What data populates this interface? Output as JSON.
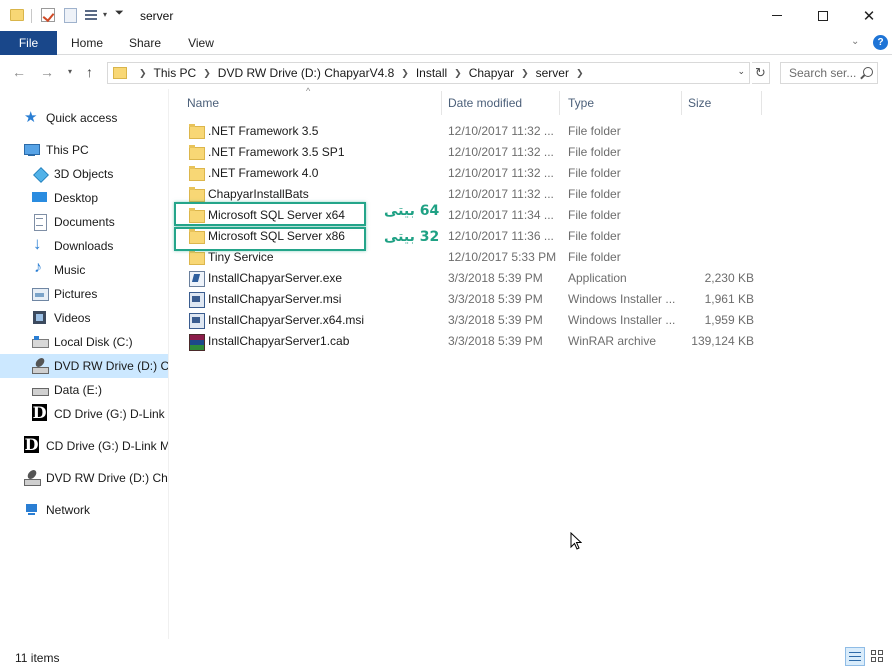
{
  "window": {
    "title": "server"
  },
  "ribbon": {
    "tabs": [
      {
        "label": "File"
      },
      {
        "label": "Home"
      },
      {
        "label": "Share"
      },
      {
        "label": "View"
      }
    ]
  },
  "address": {
    "crumbs": [
      "This PC",
      "DVD RW Drive (D:) ChapyarV4.8",
      "Install",
      "Chapyar",
      "server"
    ]
  },
  "search": {
    "placeholder": "Search ser..."
  },
  "sidebar": {
    "items": [
      {
        "label": "Quick access",
        "icon": "star-icon"
      },
      {
        "label": "This PC",
        "icon": "computer-icon"
      },
      {
        "label": "3D Objects",
        "icon": "cube-icon"
      },
      {
        "label": "Desktop",
        "icon": "desktop-icon"
      },
      {
        "label": "Documents",
        "icon": "documents-icon"
      },
      {
        "label": "Downloads",
        "icon": "download-icon"
      },
      {
        "label": "Music",
        "icon": "music-icon"
      },
      {
        "label": "Pictures",
        "icon": "pictures-icon"
      },
      {
        "label": "Videos",
        "icon": "videos-icon"
      },
      {
        "label": "Local Disk (C:)",
        "icon": "local-disk-icon"
      },
      {
        "label": "DVD RW Drive (D:) Ch",
        "icon": "dvd-drive-icon",
        "selected": true
      },
      {
        "label": "Data (E:)",
        "icon": "drive-icon"
      },
      {
        "label": "CD Drive (G:) D-Link M",
        "icon": "dlink-drive-icon"
      },
      {
        "label": "CD Drive (G:) D-Link M",
        "icon": "dlink-drive-icon"
      },
      {
        "label": "DVD RW Drive (D:) Cha",
        "icon": "dvd-drive-icon"
      },
      {
        "label": "Network",
        "icon": "network-icon"
      }
    ]
  },
  "columns": {
    "name": "Name",
    "date": "Date modified",
    "type": "Type",
    "size": "Size"
  },
  "files": [
    {
      "name": ".NET Framework 3.5",
      "date": "12/10/2017 11:32 ...",
      "type": "File folder",
      "size": "",
      "icon": "folder-icon"
    },
    {
      "name": ".NET Framework 3.5 SP1",
      "date": "12/10/2017 11:32 ...",
      "type": "File folder",
      "size": "",
      "icon": "folder-icon"
    },
    {
      "name": ".NET Framework 4.0",
      "date": "12/10/2017 11:32 ...",
      "type": "File folder",
      "size": "",
      "icon": "folder-icon"
    },
    {
      "name": "ChapyarInstallBats",
      "date": "12/10/2017 11:32 ...",
      "type": "File folder",
      "size": "",
      "icon": "folder-icon"
    },
    {
      "name": "Microsoft SQL Server x64",
      "date": "12/10/2017 11:34 ...",
      "type": "File folder",
      "size": "",
      "icon": "folder-icon"
    },
    {
      "name": "Microsoft SQL Server x86",
      "date": "12/10/2017 11:36 ...",
      "type": "File folder",
      "size": "",
      "icon": "folder-icon"
    },
    {
      "name": "Tiny Service",
      "date": "12/10/2017 5:33 PM",
      "type": "File folder",
      "size": "",
      "icon": "folder-icon"
    },
    {
      "name": "InstallChapyarServer.exe",
      "date": "3/3/2018 5:39 PM",
      "type": "Application",
      "size": "2,230 KB",
      "icon": "exe-icon"
    },
    {
      "name": "InstallChapyarServer.msi",
      "date": "3/3/2018 5:39 PM",
      "type": "Windows Installer ...",
      "size": "1,961 KB",
      "icon": "msi-icon"
    },
    {
      "name": "InstallChapyarServer.x64.msi",
      "date": "3/3/2018 5:39 PM",
      "type": "Windows Installer ...",
      "size": "1,959 KB",
      "icon": "msi-icon"
    },
    {
      "name": "InstallChapyarServer1.cab",
      "date": "3/3/2018 5:39 PM",
      "type": "WinRAR archive",
      "size": "139,124 KB",
      "icon": "cab-icon"
    }
  ],
  "annotations": {
    "x64": "64 بیتی",
    "x86": "32 بیتی",
    "color": "#1fa184"
  },
  "status": {
    "items": "11 items"
  },
  "colors": {
    "file_tab": "#19478a",
    "selection": "#cce8ff",
    "help": "#1e74d6"
  }
}
